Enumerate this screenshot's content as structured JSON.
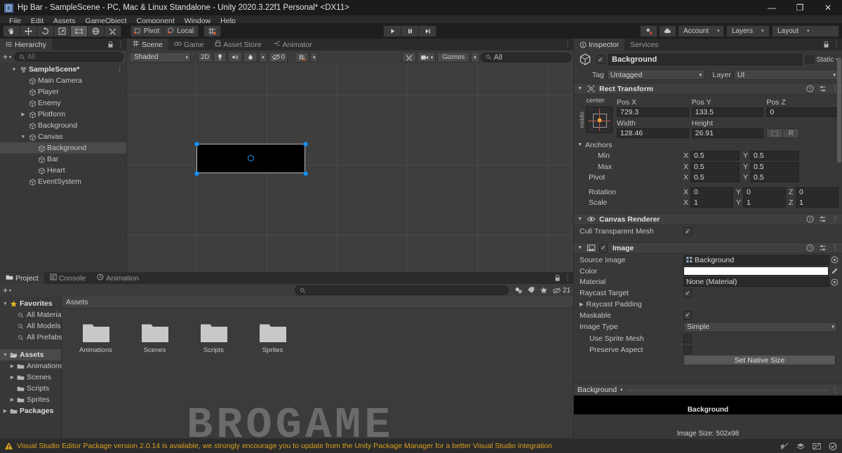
{
  "window": {
    "title": "Hp Bar - SampleScene - PC, Mac & Linux Standalone - Unity 2020.3.22f1 Personal* <DX11>",
    "minimize": "—",
    "maximize": "❐",
    "close": "✕"
  },
  "menu": {
    "items": [
      "File",
      "Edit",
      "Assets",
      "GameObject",
      "Component",
      "Window",
      "Help"
    ]
  },
  "toolbar": {
    "tools": [
      "hand-tool",
      "move-tool",
      "rotate-tool",
      "scale-tool",
      "rect-tool",
      "transform-tool",
      "custom-tool"
    ],
    "pivot_label": "Pivot",
    "space_label": "Local",
    "grid_label": "grid-snap",
    "play": "▶",
    "pause": "❙❙",
    "step": "▶❙",
    "collab_label": "collab",
    "cloud_label": "cloud",
    "account_label": "Account",
    "layers_label": "Layers",
    "layout_label": "Layout",
    "arrow": "▾"
  },
  "hierarchy": {
    "tab_label": "Hierarchy",
    "search_placeholder": "All",
    "plus": "+",
    "items": [
      {
        "label": "SampleScene*",
        "depth": 0,
        "twirl": "▼",
        "icon": "scene-icon",
        "selected": false,
        "kebab": true
      },
      {
        "label": "Main Camera",
        "depth": 1,
        "twirl": "",
        "icon": "gameobject-icon",
        "selected": false
      },
      {
        "label": "Player",
        "depth": 1,
        "twirl": "",
        "icon": "gameobject-icon",
        "selected": false
      },
      {
        "label": "Enemy",
        "depth": 1,
        "twirl": "",
        "icon": "gameobject-icon",
        "selected": false
      },
      {
        "label": "Plotform",
        "depth": 1,
        "twirl": "▶",
        "icon": "gameobject-icon",
        "selected": false
      },
      {
        "label": "Background",
        "depth": 1,
        "twirl": "",
        "icon": "gameobject-icon",
        "selected": false
      },
      {
        "label": "Canvas",
        "depth": 1,
        "twirl": "▼",
        "icon": "gameobject-icon",
        "selected": false
      },
      {
        "label": "Background",
        "depth": 2,
        "twirl": "",
        "icon": "gameobject-icon",
        "selected": true
      },
      {
        "label": "Bar",
        "depth": 2,
        "twirl": "",
        "icon": "gameobject-icon",
        "selected": false
      },
      {
        "label": "Heart",
        "depth": 2,
        "twirl": "",
        "icon": "gameobject-icon",
        "selected": false
      },
      {
        "label": "EventSystem",
        "depth": 1,
        "twirl": "",
        "icon": "gameobject-icon",
        "selected": false
      }
    ]
  },
  "scene": {
    "tabs": [
      {
        "label": "Scene",
        "icon": "scene-grid-icon",
        "active": true
      },
      {
        "label": "Game",
        "icon": "game-icon",
        "active": false
      },
      {
        "label": "Asset Store",
        "icon": "store-icon",
        "active": false
      },
      {
        "label": "Animator",
        "icon": "animator-icon",
        "active": false
      }
    ],
    "shading_mode": "Shaded",
    "mode_2d": "2D",
    "light_toggle": "lighting-icon",
    "audio_toggle": "audio-icon",
    "fx_label": "effects-icon",
    "hidden_count": "0",
    "gizmos_label": "Gizmos",
    "search_placeholder": "All",
    "arrow": "▾"
  },
  "inspector": {
    "tabs": [
      {
        "label": "Inspector",
        "icon": "info-icon",
        "active": true
      },
      {
        "label": "Services",
        "icon": "",
        "active": false
      }
    ],
    "object_name": "Background",
    "object_enabled": true,
    "static_label": "Static",
    "tag_label": "Tag",
    "tag_value": "Untagged",
    "layer_label": "Layer",
    "layer_value": "UI",
    "components": [
      {
        "title": "Rect Transform",
        "icon": "rect-transform-icon",
        "anchor_preset_label": "center",
        "anchor_preset_vlabel": "middle",
        "fields": [
          {
            "label": "Pos X",
            "value": "729.3"
          },
          {
            "label": "Pos Y",
            "value": "133.5"
          },
          {
            "label": "Pos Z",
            "value": "0"
          },
          {
            "label": "Width",
            "value": "128.46"
          },
          {
            "label": "Height",
            "value": "26.91"
          }
        ],
        "blueprint_label": "blueprint-mode-icon",
        "raw_label": "R",
        "anchors_label": "Anchors",
        "anchor_rows": [
          {
            "label": "Min",
            "x": "0.5",
            "y": "0.5"
          },
          {
            "label": "Max",
            "x": "0.5",
            "y": "0.5"
          },
          {
            "label": "Pivot",
            "x": "0.5",
            "y": "0.5"
          }
        ],
        "rotation_label": "Rotation",
        "rotation": {
          "x": "0",
          "y": "0",
          "z": "0"
        },
        "scale_label": "Scale",
        "scale": {
          "x": "1",
          "y": "1",
          "z": "1"
        }
      },
      {
        "title": "Canvas Renderer",
        "icon": "canvas-renderer-icon",
        "props": [
          {
            "label": "Cull Transparent Mesh",
            "type": "checkbox",
            "value": true
          }
        ]
      },
      {
        "title": "Image",
        "icon": "image-icon",
        "enabled": true,
        "props": [
          {
            "label": "Source Image",
            "type": "object",
            "value": "Background"
          },
          {
            "label": "Color",
            "type": "color",
            "value": "#ffffff"
          },
          {
            "label": "Material",
            "type": "object",
            "value": "None (Material)"
          },
          {
            "label": "Raycast Target",
            "type": "checkbox",
            "value": true
          },
          {
            "label": "Raycast Padding",
            "type": "foldout",
            "value": ""
          },
          {
            "label": "Maskable",
            "type": "checkbox",
            "value": true
          },
          {
            "label": "Image Type",
            "type": "dropdown",
            "value": "Simple"
          },
          {
            "label": "Use Sprite Mesh",
            "type": "checkbox-indent",
            "value": false
          },
          {
            "label": "Preserve Aspect",
            "type": "checkbox-indent",
            "value": false
          }
        ],
        "native_size_button": "Set Native Size"
      }
    ],
    "help_icon": "help-icon",
    "preset_icon": "preset-icon",
    "kebab_icon": "⋮",
    "preview": {
      "name": "Background",
      "asset_name": "Background",
      "image_size_label": "Image Size: 502x98",
      "arrow": "▾"
    }
  },
  "project": {
    "tabs": [
      {
        "label": "Project",
        "icon": "folder-icon",
        "active": true
      },
      {
        "label": "Console",
        "icon": "console-icon",
        "active": false
      },
      {
        "label": "Animation",
        "icon": "animation-icon",
        "active": false
      }
    ],
    "plus": "+",
    "search_placeholder": "",
    "badge_count": "21",
    "breadcrumb": "Assets",
    "tree": [
      {
        "label": "Favorites",
        "depth": 0,
        "twirl": "▼",
        "icon": "star-icon",
        "selected": false
      },
      {
        "label": "All Materials",
        "depth": 1,
        "twirl": "",
        "icon": "search-small-icon",
        "selected": false
      },
      {
        "label": "All Models",
        "depth": 1,
        "twirl": "",
        "icon": "search-small-icon",
        "selected": false
      },
      {
        "label": "All Prefabs",
        "depth": 1,
        "twirl": "",
        "icon": "search-small-icon",
        "selected": false
      },
      {
        "label": "",
        "depth": 0,
        "twirl": "",
        "icon": "",
        "spacer": true
      },
      {
        "label": "Assets",
        "depth": 0,
        "twirl": "▼",
        "icon": "folder-open-icon",
        "selected": true
      },
      {
        "label": "Animations",
        "depth": 1,
        "twirl": "▶",
        "icon": "folder-icon",
        "selected": false
      },
      {
        "label": "Scenes",
        "depth": 1,
        "twirl": "▶",
        "icon": "folder-icon",
        "selected": false
      },
      {
        "label": "Scripts",
        "depth": 1,
        "twirl": "",
        "icon": "folder-icon",
        "selected": false
      },
      {
        "label": "Sprites",
        "depth": 1,
        "twirl": "▶",
        "icon": "folder-icon",
        "selected": false
      },
      {
        "label": "Packages",
        "depth": 0,
        "twirl": "▶",
        "icon": "folder-icon",
        "selected": false
      }
    ],
    "assets": [
      {
        "name": "Animations",
        "icon": "folder-icon"
      },
      {
        "name": "Scenes",
        "icon": "folder-icon"
      },
      {
        "name": "Scripts",
        "icon": "folder-icon"
      },
      {
        "name": "Sprites",
        "icon": "folder-icon"
      }
    ],
    "watermark": "BROGAME"
  },
  "statusbar": {
    "warning_icon": "warning-icon",
    "message": "Visual Studio Editor Package version 2.0.14 is available, we strongly encourage you to update from the Unity Package Manager for a better Visual Studio integration",
    "icons": [
      "mute-audio-icon",
      "layers-status-icon",
      "no-preview-icon",
      "ready-check-icon"
    ]
  },
  "colors": {
    "accent_blue": "#2196f3",
    "warning": "#d9a021",
    "panel_bg": "#383838",
    "toolbar_bg": "#1e1e1e"
  }
}
